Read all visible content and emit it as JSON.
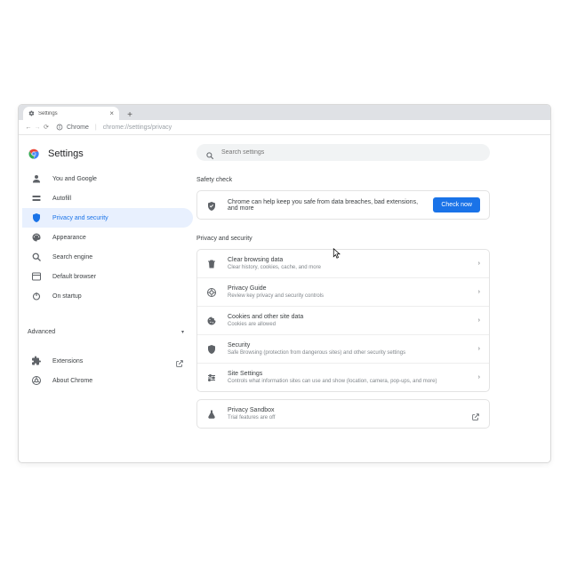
{
  "browser_tab": {
    "title": "Settings"
  },
  "addressbar": {
    "host": "Chrome",
    "path": "chrome://settings/privacy"
  },
  "header": {
    "title": "Settings"
  },
  "sidebar": {
    "items": [
      {
        "label": "You and Google"
      },
      {
        "label": "Autofill"
      },
      {
        "label": "Privacy and security"
      },
      {
        "label": "Appearance"
      },
      {
        "label": "Search engine"
      },
      {
        "label": "Default browser"
      },
      {
        "label": "On startup"
      }
    ],
    "advanced": "Advanced",
    "extensions": "Extensions",
    "about": "About Chrome"
  },
  "search": {
    "placeholder": "Search settings"
  },
  "safety_check": {
    "heading": "Safety check",
    "message": "Chrome can help keep you safe from data breaches, bad extensions, and more",
    "button": "Check now"
  },
  "privacy": {
    "heading": "Privacy and security",
    "items": [
      {
        "title": "Clear browsing data",
        "subtitle": "Clear history, cookies, cache, and more"
      },
      {
        "title": "Privacy Guide",
        "subtitle": "Review key privacy and security controls"
      },
      {
        "title": "Cookies and other site data",
        "subtitle": "Cookies are allowed"
      },
      {
        "title": "Security",
        "subtitle": "Safe Browsing (protection from dangerous sites) and other security settings"
      },
      {
        "title": "Site Settings",
        "subtitle": "Controls what information sites can use and show (location, camera, pop-ups, and more)"
      },
      {
        "title": "Privacy Sandbox",
        "subtitle": "Trial features are off"
      }
    ]
  }
}
